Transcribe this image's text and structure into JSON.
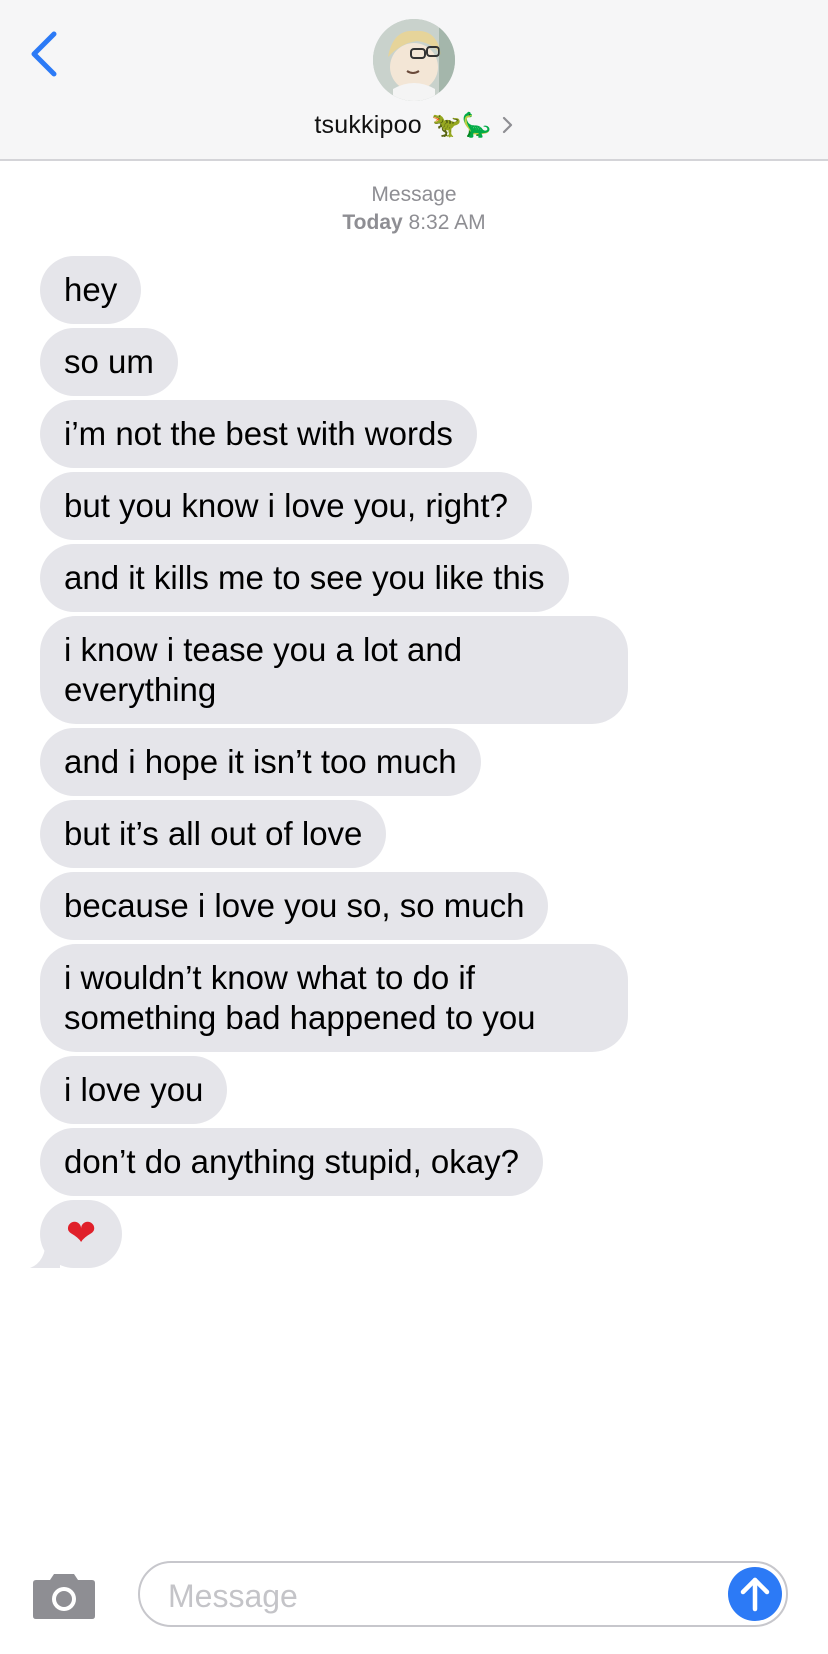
{
  "header": {
    "contact_name": "tsukkipoo",
    "contact_emojis": "🦖🦕",
    "back_icon": "chevron-left-icon",
    "detail_icon": "chevron-right-icon",
    "avatar_icon": "contact-avatar"
  },
  "meta": {
    "service": "Message",
    "day": "Today",
    "time": "8:32 AM"
  },
  "messages": [
    "hey",
    "so um",
    "i’m not the best with words",
    "but you know i love you, right?",
    "and it kills me to see you like this",
    "i know i tease you a lot and everything",
    "and i hope it isn’t too much",
    "but it’s all out of love",
    "because i love you so, so much",
    "i wouldn’t know what to do if something bad happened to you",
    "i love you",
    "don’t do anything stupid, okay?",
    "❤"
  ],
  "composer": {
    "placeholder": "Message",
    "camera_icon": "camera-icon",
    "send_icon": "arrow-up-icon"
  },
  "colors": {
    "accent": "#2c7af6",
    "incoming_bubble": "#e5e5ea",
    "header_bg": "#f6f6f7",
    "meta_text": "#8e8e93"
  }
}
